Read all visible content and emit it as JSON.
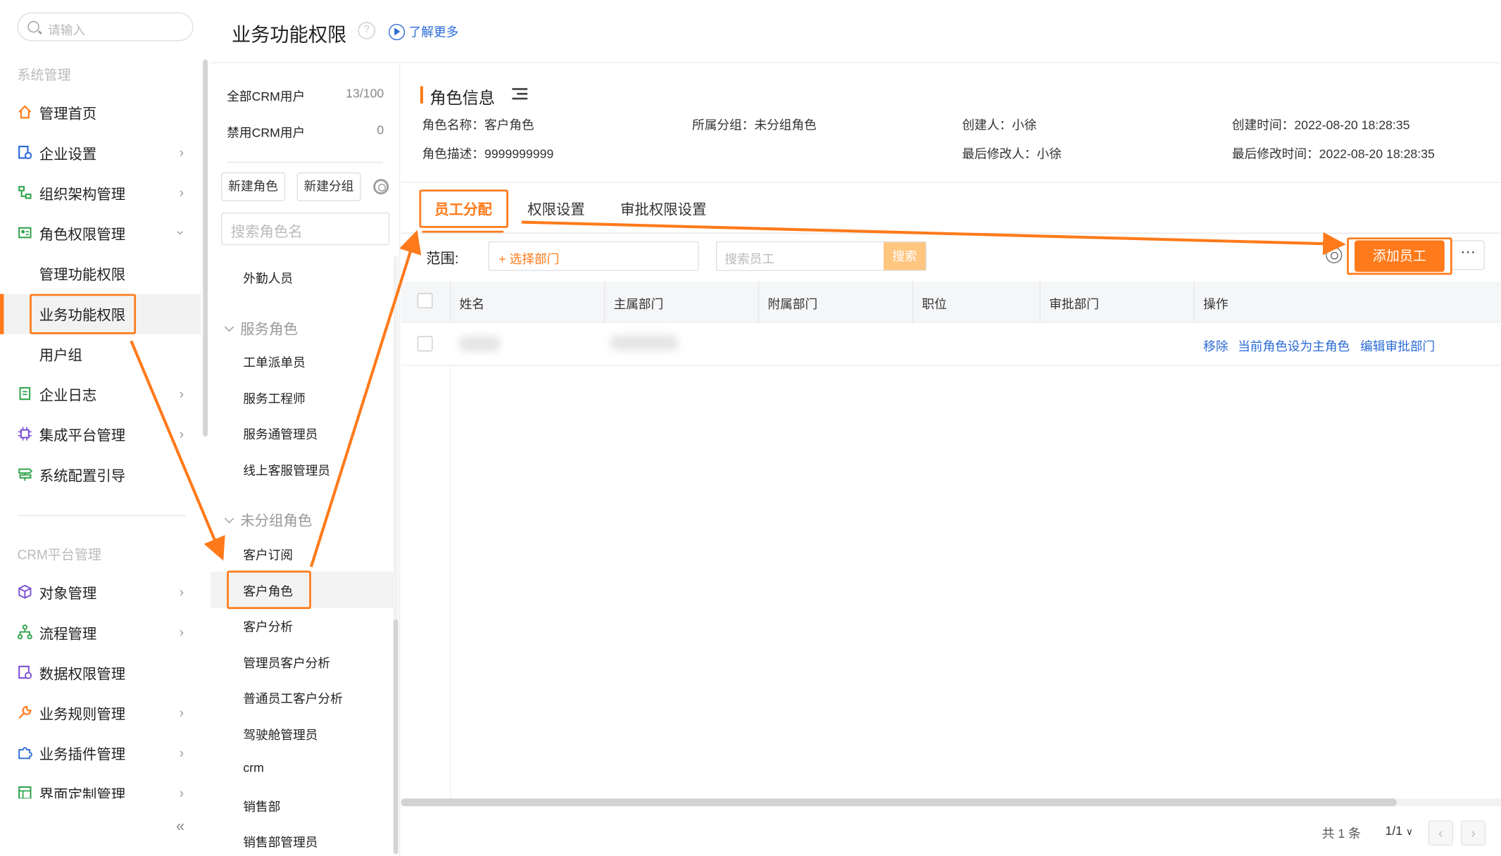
{
  "nav": {
    "search_placeholder": "请输入",
    "section1": "系统管理",
    "items1": [
      {
        "label": "管理首页",
        "icon": "home-icon"
      },
      {
        "label": "企业设置",
        "icon": "enterprise-settings-icon"
      },
      {
        "label": "组织架构管理",
        "icon": "org-chart-icon"
      },
      {
        "label": "角色权限管理",
        "icon": "role-permission-icon"
      }
    ],
    "sub_items": [
      "管理功能权限",
      "业务功能权限",
      "用户组"
    ],
    "items2": [
      {
        "label": "企业日志",
        "icon": "log-icon"
      },
      {
        "label": "集成平台管理",
        "icon": "integration-chip-icon"
      },
      {
        "label": "系统配置引导",
        "icon": "signpost-icon"
      }
    ],
    "section2": "CRM平台管理",
    "items3": [
      {
        "label": "对象管理",
        "icon": "object-cube-icon"
      },
      {
        "label": "流程管理",
        "icon": "process-flow-icon"
      },
      {
        "label": "数据权限管理",
        "icon": "data-permission-icon"
      },
      {
        "label": "业务规则管理",
        "icon": "wrench-icon"
      },
      {
        "label": "业务插件管理",
        "icon": "puzzle-icon"
      },
      {
        "label": "界面定制管理",
        "icon": "layout-icon"
      }
    ],
    "collapse": "«"
  },
  "header": {
    "title": "业务功能权限",
    "help": "?",
    "learn_more": "了解更多"
  },
  "roles": {
    "all_users_label": "全部CRM用户",
    "all_users_value": "13/100",
    "disabled_label": "禁用CRM用户",
    "disabled_value": "0",
    "new_role": "新建角色",
    "new_group": "新建分组",
    "search_placeholder": "搜索角色名",
    "top_item": "外勤人员",
    "group1": "服务角色",
    "group1_items": [
      "工单派单员",
      "服务工程师",
      "服务通管理员",
      "线上客服管理员"
    ],
    "group2": "未分组角色",
    "group2_items": [
      "客户订阅",
      "客户角色",
      "客户分析",
      "管理员客户分析",
      "普通员工客户分析",
      "驾驶舱管理员",
      "crm",
      "销售部",
      "销售部管理员"
    ]
  },
  "info": {
    "title": "角色信息",
    "name": "角色名称：客户角色",
    "group": "所属分组：未分组角色",
    "creator": "创建人：小徐",
    "created_at": "创建时间：2022-08-20 18:28:35",
    "desc": "角色描述：9999999999",
    "modifier": "最后修改人：小徐",
    "modified_at": "最后修改时间：2022-08-20 18:28:35"
  },
  "tabs": [
    "员工分配",
    "权限设置",
    "审批权限设置"
  ],
  "toolbar": {
    "scope_label": "范围:",
    "dept_select": "+ 选择部门",
    "emp_placeholder": "搜索员工",
    "search_btn": "搜索",
    "add_employee": "添加员工",
    "more": "···"
  },
  "table": {
    "columns": [
      "姓名",
      "主属部门",
      "附属部门",
      "职位",
      "审批部门",
      "操作"
    ],
    "actions": [
      "移除",
      "当前角色设为主角色",
      "编辑审批部门"
    ]
  },
  "pagination": {
    "total": "共 1 条",
    "page": "1/1",
    "prev": "‹",
    "next": "›"
  },
  "colors": {
    "accent": "#ff7a1a",
    "link": "#2b6bd6"
  }
}
